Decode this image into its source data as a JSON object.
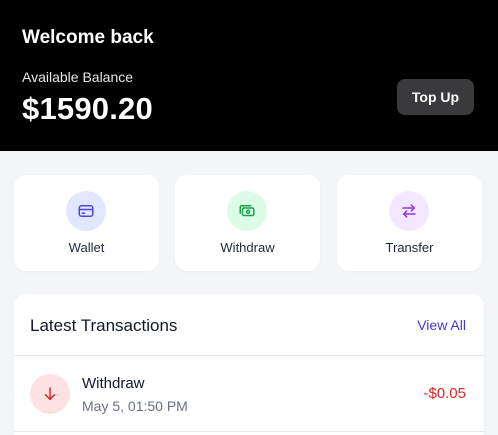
{
  "header": {
    "welcome": "Welcome back",
    "balance_label": "Available Balance",
    "balance": "$1590.20",
    "top_up_label": "Top Up"
  },
  "actions": [
    {
      "label": "Wallet",
      "icon": "wallet-icon",
      "color": "#4f46e5"
    },
    {
      "label": "Withdraw",
      "icon": "cash-icon",
      "color": "#16a34a"
    },
    {
      "label": "Transfer",
      "icon": "transfer-arrows-icon",
      "color": "#9333ea"
    }
  ],
  "transactions": {
    "title": "Latest Transactions",
    "view_all": "View All",
    "items": [
      {
        "title": "Withdraw",
        "date": "May 5, 01:50 PM",
        "amount": "-$0.05",
        "icon": "arrow-down-icon",
        "color": "#dc2626"
      }
    ]
  }
}
